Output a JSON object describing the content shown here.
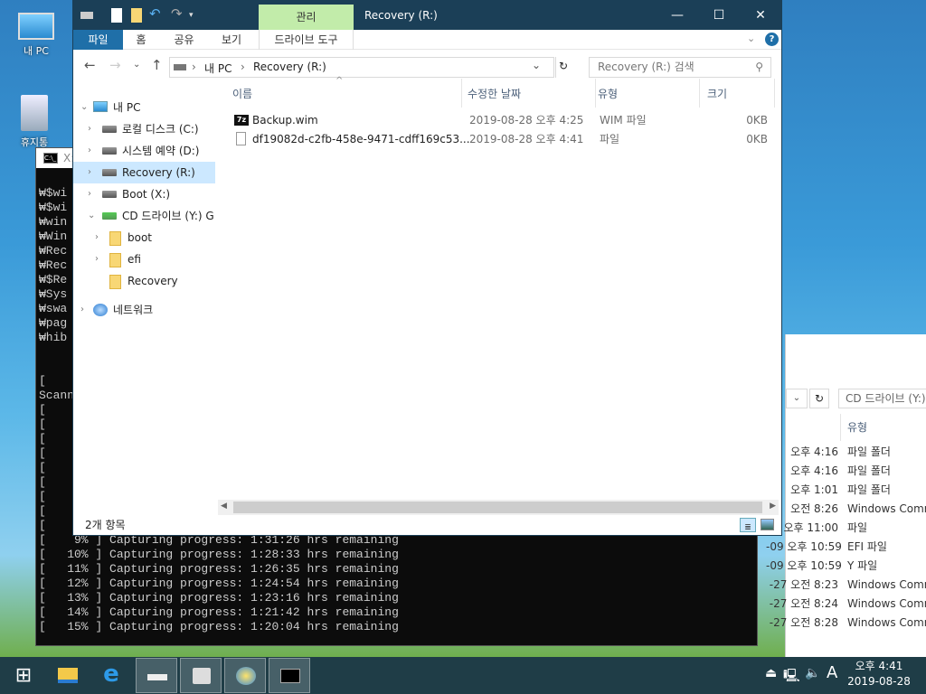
{
  "desktop": {
    "icons": [
      {
        "label": "내 PC",
        "icon": "computer-icon"
      },
      {
        "label": "휴지통",
        "icon": "recycle-bin-icon"
      }
    ]
  },
  "console": {
    "title": "X:",
    "lines": [
      "₩$wi",
      "₩$wi",
      "₩win",
      "₩Win",
      "₩Rec",
      "₩Rec",
      "₩$Re",
      "₩Sys",
      "₩swa",
      "₩pag",
      "₩hib",
      "",
      "",
      "[    0",
      "Scann",
      "[    0",
      "[    1",
      "[    2",
      "[    3",
      "[    4",
      "[    5",
      "[    6",
      "[    7",
      "[    8",
      "[    9% ] Capturing progress: 1:31:26 hrs remaining",
      "[   10% ] Capturing progress: 1:28:33 hrs remaining",
      "[   11% ] Capturing progress: 1:26:35 hrs remaining",
      "[   12% ] Capturing progress: 1:24:54 hrs remaining",
      "[   13% ] Capturing progress: 1:23:16 hrs remaining",
      "[   14% ] Capturing progress: 1:21:42 hrs remaining",
      "[   15% ] Capturing progress: 1:20:04 hrs remaining"
    ]
  },
  "back_window": {
    "search": "CD 드라이브 (Y:)",
    "col_type": "유형",
    "rows": [
      {
        "date": "오후 4:16",
        "type": "파일 폴더"
      },
      {
        "date": "오후 4:16",
        "type": "파일 폴더"
      },
      {
        "date": "오후 1:01",
        "type": "파일 폴더"
      },
      {
        "date": "오전 8:26",
        "type": "Windows Comm"
      },
      {
        "date": "오후 11:00",
        "type": "파일"
      },
      {
        "date": "-09 오후 10:59",
        "type": "EFI 파일"
      },
      {
        "date": "-09 오후 10:59",
        "type": "Y 파일"
      },
      {
        "date": "-27 오전 8:23",
        "type": "Windows Comm"
      },
      {
        "date": "-27 오전 8:24",
        "type": "Windows Comm"
      },
      {
        "date": "-27 오전 8:28",
        "type": "Windows Comm"
      }
    ]
  },
  "explorer": {
    "context_tab": "관리",
    "title": "Recovery (R:)",
    "tabs": [
      "파일",
      "홈",
      "공유",
      "보기",
      "드라이브 도구"
    ],
    "breadcrumb": [
      "내 PC",
      "Recovery (R:)"
    ],
    "search_placeholder": "Recovery (R:) 검색",
    "tree": [
      {
        "label": "내 PC",
        "icon": "computer-icon"
      },
      {
        "label": "로컬 디스크 (C:)",
        "icon": "windows-drive-icon"
      },
      {
        "label": "시스템 예약 (D:)",
        "icon": "drive-icon"
      },
      {
        "label": "Recovery (R:)",
        "icon": "drive-icon",
        "selected": true
      },
      {
        "label": "Boot (X:)",
        "icon": "windows-drive-icon"
      },
      {
        "label": "CD 드라이브 (Y:) G",
        "icon": "cd-drive-icon"
      },
      {
        "label": "boot",
        "icon": "folder-icon"
      },
      {
        "label": "efi",
        "icon": "folder-icon"
      },
      {
        "label": "Recovery",
        "icon": "folder-icon"
      },
      {
        "label": "네트워크",
        "icon": "network-icon"
      }
    ],
    "columns": [
      "이름",
      "수정한 날짜",
      "유형",
      "크기"
    ],
    "files": [
      {
        "name": "Backup.wim",
        "date": "2019-08-28 오후 4:25",
        "type": "WIM 파일",
        "size": "0KB",
        "icon": "7z-icon"
      },
      {
        "name": "df19082d-c2fb-458e-9471-cdff169c53...",
        "date": "2019-08-28 오후 4:41",
        "type": "파일",
        "size": "0KB",
        "icon": "file-icon"
      }
    ],
    "status": "2개 항목"
  },
  "taskbar": {
    "time": "오후 4:41",
    "date": "2019-08-28",
    "ime": "A"
  },
  "colors": {
    "titlebar": "#1b3f57",
    "file_tab": "#1f6fa8",
    "context_tab": "#c2ecaa",
    "selection": "#cce8ff",
    "taskbar": "#1f3d47"
  }
}
